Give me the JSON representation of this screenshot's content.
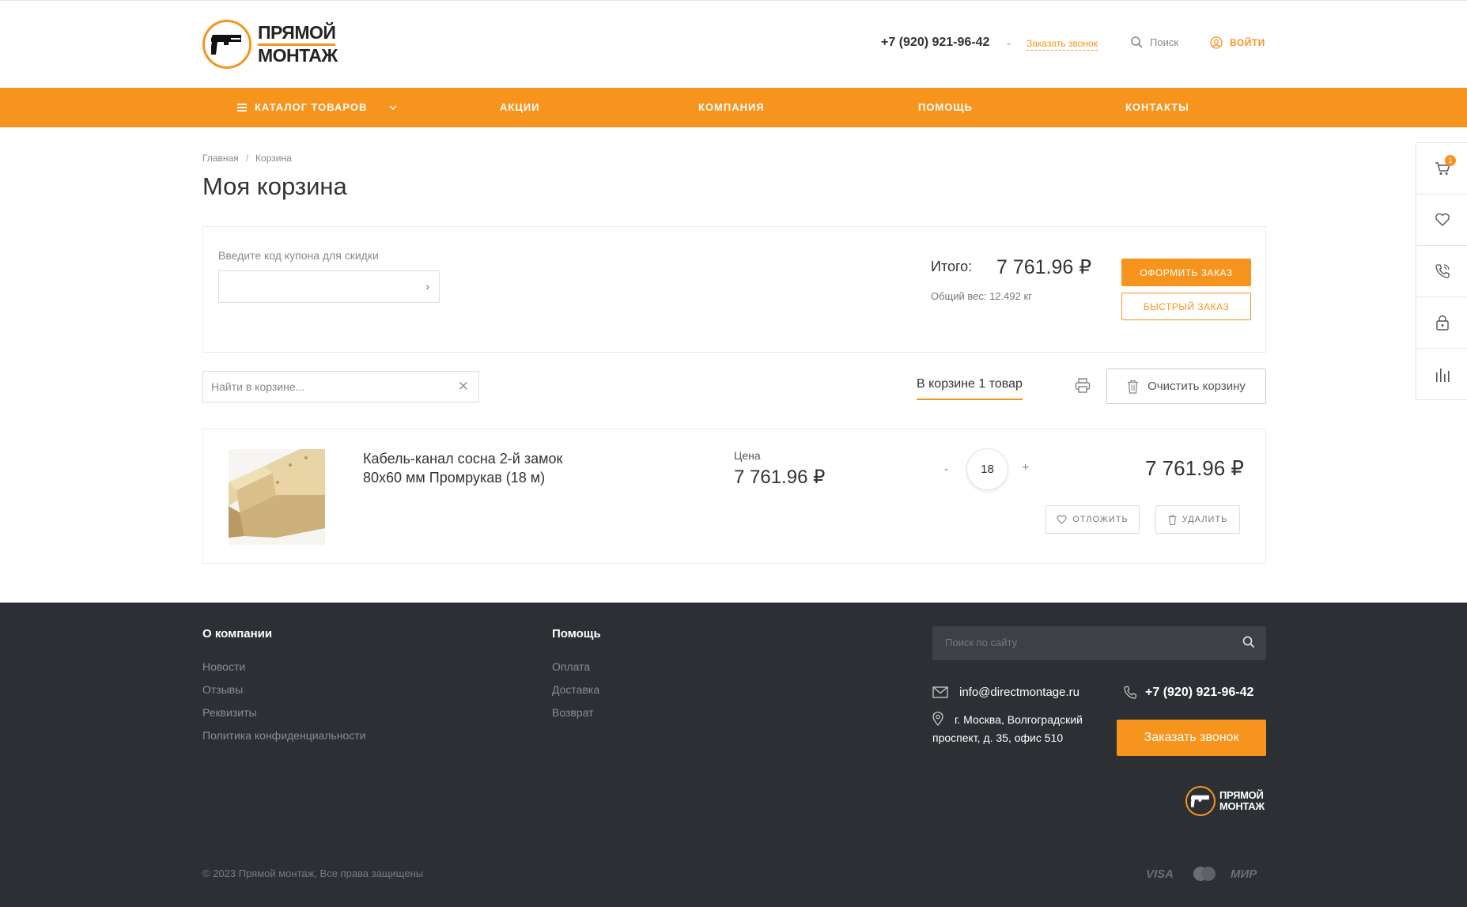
{
  "header": {
    "logo_line1": "ПРЯМОЙ",
    "logo_line2": "МОНТАЖ",
    "phone": "+7 (920) 921-96-42",
    "callback": "Заказать звонок",
    "search": "Поиск",
    "login": "ВОЙТИ"
  },
  "nav": {
    "catalog": "КАТАЛОГ ТОВАРОВ",
    "items": [
      "АКЦИИ",
      "КОМПАНИЯ",
      "ПОМОЩЬ",
      "КОНТАКТЫ"
    ]
  },
  "side": {
    "cart_badge": "1"
  },
  "breadcrumb": {
    "home": "Главная",
    "sep": "/",
    "current": "Корзина"
  },
  "title": "Моя корзина",
  "summary": {
    "coupon_label": "Введите код купона для скидки",
    "coupon_arrow": "›",
    "total_label": "Итого:",
    "total_value": "7 761.96 ₽",
    "weight": "Общий вес: 12.492 кг",
    "order_button": "ОФОРМИТЬ ЗАКАЗ",
    "quick_button": "БЫСТРЫЙ ЗАКАЗ"
  },
  "toolbar": {
    "search_placeholder": "Найти в корзине...",
    "clear_x": "✕",
    "count": "В корзине 1 товар",
    "clear_button": "Очистить корзину"
  },
  "item": {
    "name": "Кабель-канал сосна 2-й замок 80х60 мм Промрукав (18 м)",
    "price_label": "Цена",
    "price": "7 761.96 ₽",
    "qty_minus": "-",
    "qty": "18",
    "qty_plus": "+",
    "sum": "7 761.96 ₽",
    "defer": "ОТЛОЖИТЬ",
    "delete": "УДАЛИТЬ"
  },
  "footer": {
    "col1_title": "О компании",
    "col1_links": [
      "Новости",
      "Отзывы",
      "Реквизиты",
      "Политика конфиденциальности"
    ],
    "col2_title": "Помощь",
    "col2_links": [
      "Оплата",
      "Доставка",
      "Возврат"
    ],
    "search_placeholder": "Поиск по сайту",
    "email": "info@directmontage.ru",
    "phone": "+7 (920) 921-96-42",
    "address": "г. Москва, Волгоградский проспект, д. 35, офис 510",
    "callback": "Заказать звонок",
    "logo_line1": "ПРЯМОЙ",
    "logo_line2": "МОНТАЖ",
    "copyright": "© 2023 Прямой монтаж, Все права защищены",
    "payments": [
      "VISA",
      "МИР"
    ]
  },
  "colors": {
    "accent": "#f7941d",
    "footer_bg": "#2c2f33"
  }
}
